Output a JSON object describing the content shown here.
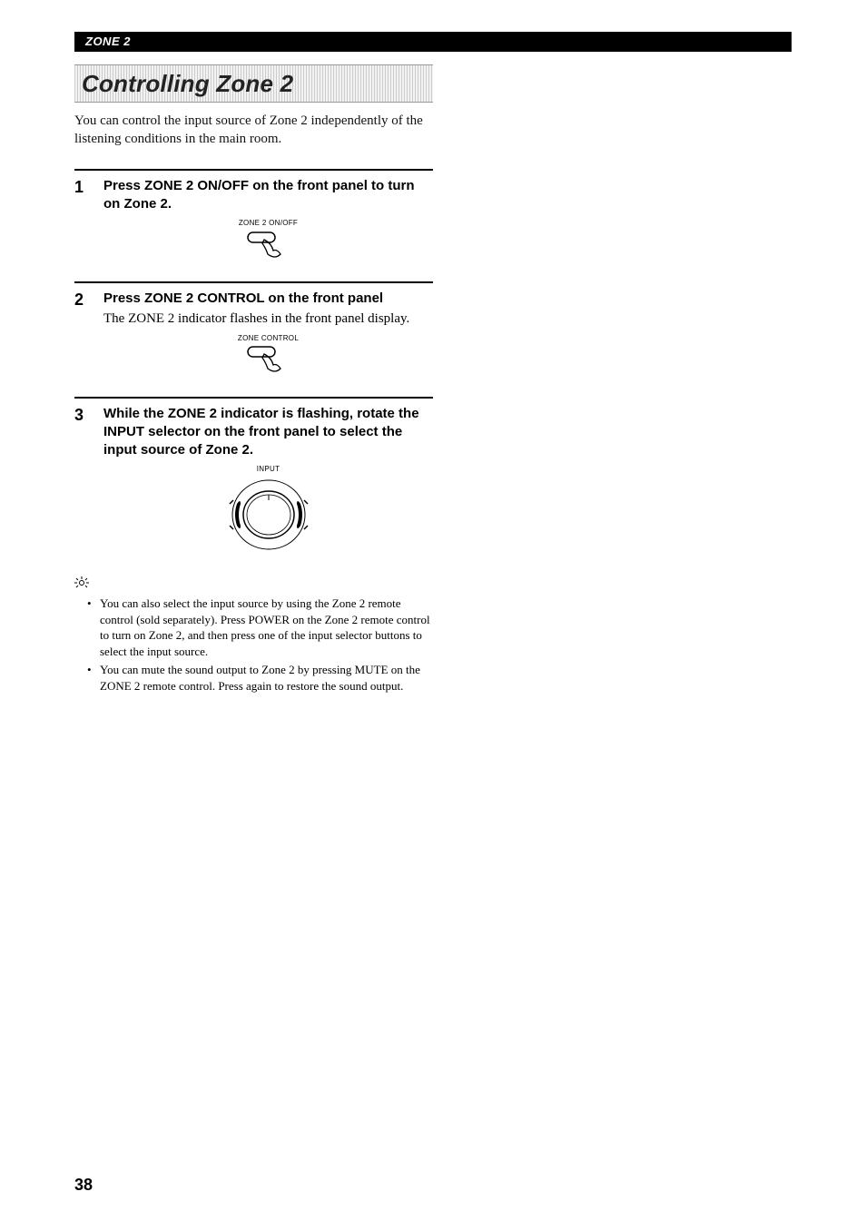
{
  "header": {
    "section_label": "ZONE 2"
  },
  "title": "Controlling Zone 2",
  "intro": "You can control the input source of Zone 2 independently of the listening conditions in the main room.",
  "steps": [
    {
      "num": "1",
      "heading": "Press ZONE 2 ON/OFF on the front panel to turn on Zone 2.",
      "subtext": "",
      "diagram_label": "ZONE 2 ON/OFF",
      "diagram_type": "button"
    },
    {
      "num": "2",
      "heading": "Press ZONE 2 CONTROL on the front panel",
      "subtext": "The ZONE 2 indicator flashes in the front panel display.",
      "diagram_label": "ZONE CONTROL",
      "diagram_type": "button"
    },
    {
      "num": "3",
      "heading": "While the ZONE 2 indicator is flashing, rotate the INPUT selector on the front panel to select the input source of Zone 2.",
      "subtext": "",
      "diagram_label": "INPUT",
      "diagram_type": "dial"
    }
  ],
  "tips": [
    "You can also select the input source by using the Zone 2 remote control (sold separately). Press POWER on the Zone 2 remote control to turn on Zone 2, and then press one of the input selector buttons to select the input source.",
    "You can mute the sound output to Zone 2 by pressing MUTE on the ZONE 2 remote control. Press again to restore the sound output."
  ],
  "page_number": "38"
}
